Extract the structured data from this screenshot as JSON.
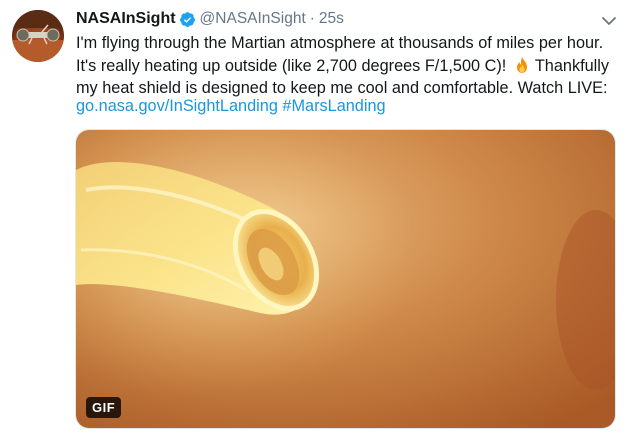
{
  "tweet": {
    "author_name": "NASAInSight",
    "handle": "@NASAInSight",
    "separator": "·",
    "timestamp": "25s",
    "text_part1": "I'm flying through the Martian atmosphere at thousands of miles per hour. It's really heating up outside (like 2,700 degrees F/1,500 C)!",
    "text_part2": "Thankfully my heat shield is designed to keep me cool and comfortable. Watch LIVE:",
    "link_url": "go.nasa.gov/InSightLanding",
    "hashtag": "#MarsLanding",
    "media_badge": "GIF"
  },
  "icons": {
    "verified": "verified-badge-icon",
    "caret": "chevron-down-icon",
    "emoji": "fire-emoji"
  },
  "colors": {
    "link": "#1b95e0",
    "verified": "#1da1f2",
    "muted": "#657786",
    "text": "#14171a"
  }
}
